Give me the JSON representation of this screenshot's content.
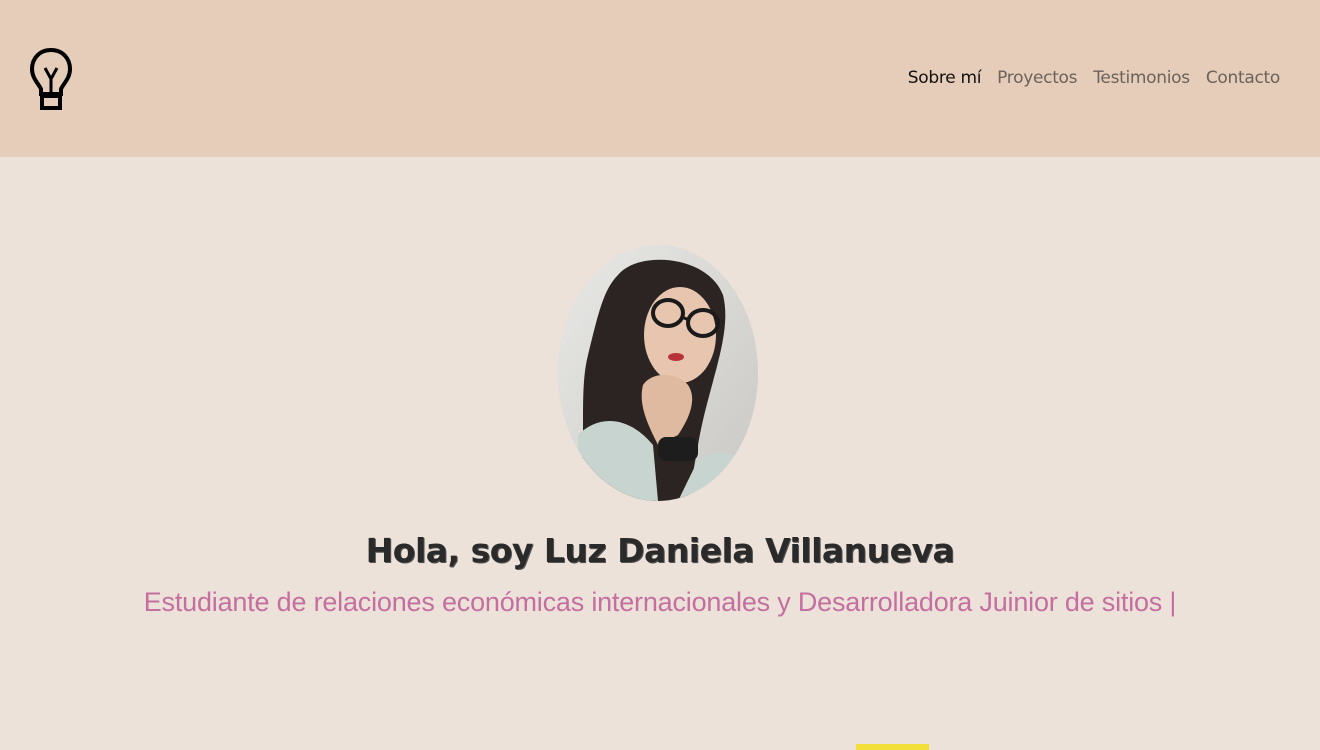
{
  "header": {
    "logo_icon": "lightbulb-icon",
    "nav": [
      {
        "label": "Sobre mí",
        "active": true
      },
      {
        "label": "Proyectos",
        "active": false
      },
      {
        "label": "Testimonios",
        "active": false
      },
      {
        "label": "Contacto",
        "active": false
      }
    ]
  },
  "hero": {
    "title": "Hola, soy Luz Daniela Villanueva",
    "subtitle": "Estudiante de relaciones económicas internacionales y Desarrolladora Juinior de sitios |"
  },
  "colors": {
    "header_bg": "#e5cdb9",
    "page_bg": "#ede2d9",
    "subtitle": "#c46fa0",
    "accent_yellow": "#f2df3a"
  }
}
